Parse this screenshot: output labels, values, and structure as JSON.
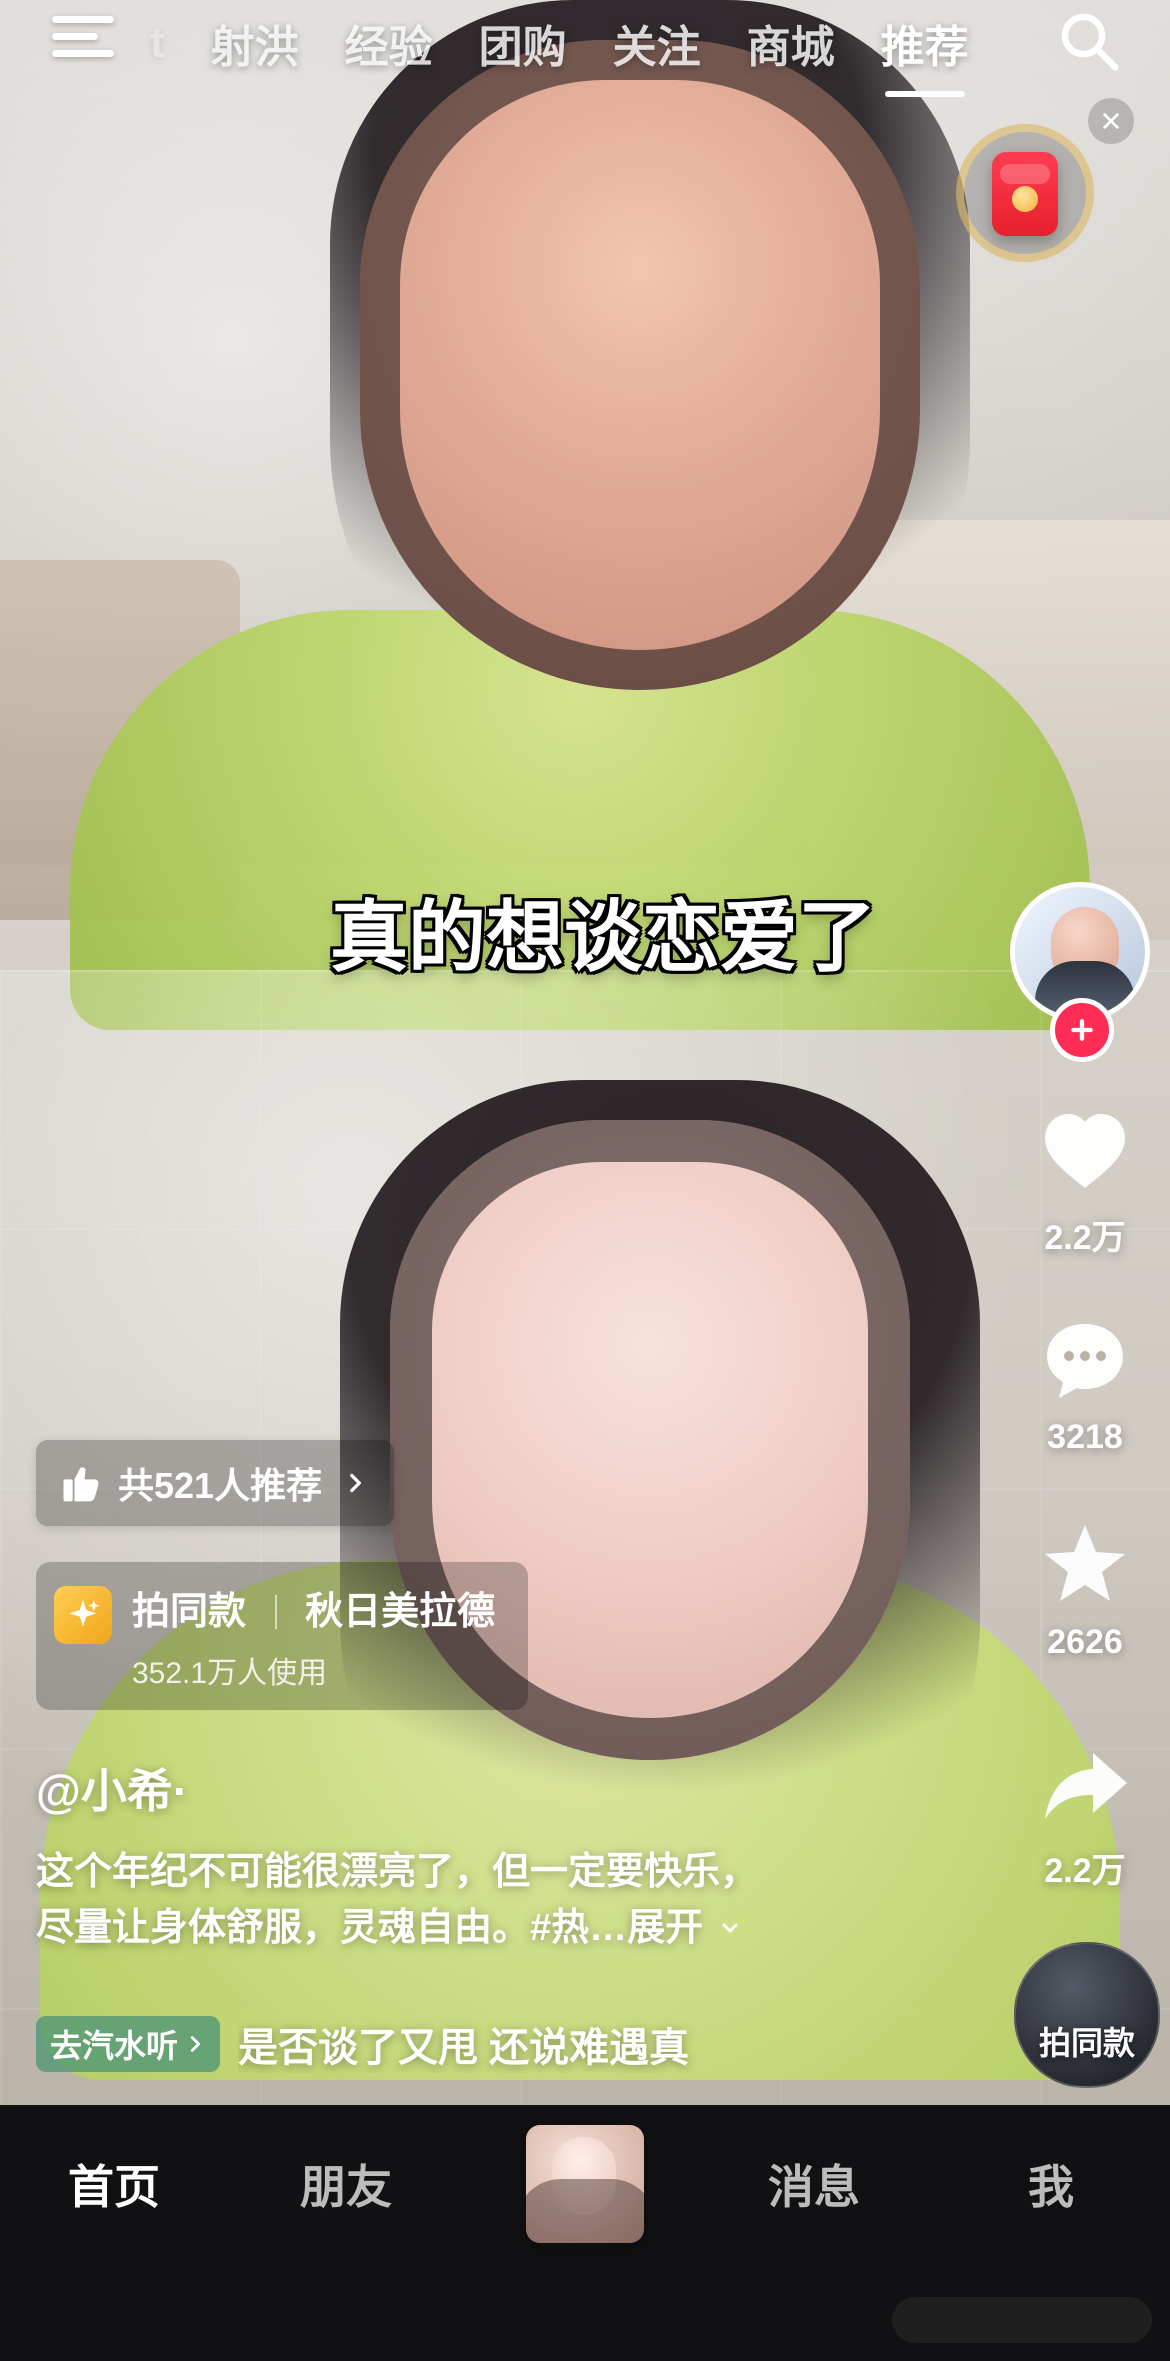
{
  "top_tabs": [
    "射洪",
    "经验",
    "团购",
    "关注",
    "商城",
    "推荐"
  ],
  "active_tab_index": 5,
  "top_left_faint": "t",
  "subtitle": "真的想谈恋爱了",
  "right_rail": {
    "likes": "2.2万",
    "comments": "3218",
    "favorites": "2626",
    "shares": "2.2万",
    "same_style_label": "拍同款"
  },
  "overlay": {
    "recommend_pill": "共521人推荐",
    "same_style_card": {
      "left": "拍同款",
      "right": "秋日美拉德",
      "sub": "352.1万人使用"
    },
    "author": "@小希·",
    "description_line1": "这个年纪不可能很漂亮了，但一定要快乐，",
    "description_line2_prefix": "尽量让身体舒服，灵魂自由。#热…",
    "description_more": "展开",
    "music_pill": "去汽水听",
    "music_text": "是否谈了又甩 还说难遇真"
  },
  "bottom_nav": {
    "home": "首页",
    "friends": "朋友",
    "messages": "消息",
    "me": "我"
  },
  "icons": {
    "menu": "menu-icon",
    "search": "search-icon",
    "close": "close-icon",
    "red_packet": "red-packet-icon",
    "heart": "heart-icon",
    "comment": "comment-icon",
    "star": "star-icon",
    "share": "share-icon",
    "thumb_up": "thumb-up-icon",
    "chevron_right": "chevron-right-icon",
    "sparkle": "sparkle-icon",
    "plus": "plus-icon"
  },
  "colors": {
    "accent_red": "#ff2c55",
    "nav_bg": "#111113",
    "music_pill": "#4e9676"
  }
}
